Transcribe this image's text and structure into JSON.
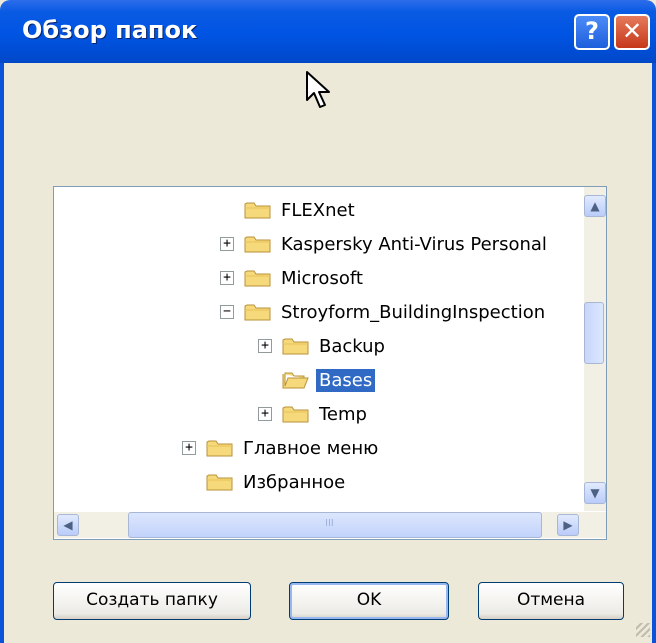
{
  "window": {
    "title": "Обзор папок",
    "help_glyph": "?",
    "close_glyph": "✕"
  },
  "tree": {
    "items": [
      {
        "label": "FLEXnet",
        "expander": ""
      },
      {
        "label": "Kaspersky Anti-Virus Personal",
        "expander": "+"
      },
      {
        "label": "Microsoft",
        "expander": "+"
      },
      {
        "label": "Stroyform_BuildingInspection",
        "expander": "−"
      },
      {
        "label": "Backup",
        "expander": "+"
      },
      {
        "label": "Bases",
        "expander": "",
        "selected": true
      },
      {
        "label": "Temp",
        "expander": "+"
      },
      {
        "label": "Главное меню",
        "expander": "+"
      },
      {
        "label": "Избранное",
        "expander": ""
      }
    ]
  },
  "scrollbars": {
    "up": "▲",
    "down": "▼",
    "left": "◀",
    "right": "▶",
    "hthumb_grip": "III"
  },
  "buttons": {
    "new_folder": "Создать папку",
    "ok": "OK",
    "cancel": "Отмена"
  },
  "colors": {
    "titlebar": "#0054E3",
    "selection": "#316AC5",
    "face": "#ECE9D8",
    "folder": "#F6D97B"
  }
}
